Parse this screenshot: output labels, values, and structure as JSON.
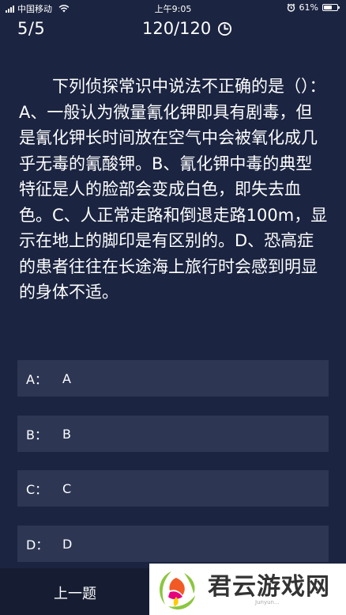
{
  "status_bar": {
    "carrier": "中国移动",
    "time": "上午9:05",
    "battery": "61%",
    "battery_level": 0.61
  },
  "quiz": {
    "progress": "5/5",
    "timer": "120/120",
    "question": "下列侦探常识中说法不正确的是（）：A、一般认为微量氰化钾即具有剧毒，但是氰化钾长时间放在空气中会被氧化成几乎无毒的氰酸钾。B、氰化钾中毒的典型特征是人的脸部会变成白色，即失去血色。C、人正常走路和倒退走路100m，显示在地上的脚印是有区别的。D、恐高症的患者往往在长途海上旅行时会感到明显的身体不适。",
    "options": [
      {
        "key": "A：",
        "value": "A"
      },
      {
        "key": "B：",
        "value": "B"
      },
      {
        "key": "C：",
        "value": "C"
      },
      {
        "key": "D：",
        "value": "D"
      }
    ]
  },
  "nav": {
    "prev_label": "上一题"
  },
  "watermark": {
    "title": "君云游戏网",
    "subtitle": "Junyun..."
  },
  "colors": {
    "background": "#1b2440",
    "option_background": "#2d3754",
    "bottom_bar": "#161d33"
  },
  "icons": {
    "clock": "clock-icon",
    "wifi": "wifi-icon",
    "alarm": "alarm-icon",
    "battery": "battery-icon"
  }
}
